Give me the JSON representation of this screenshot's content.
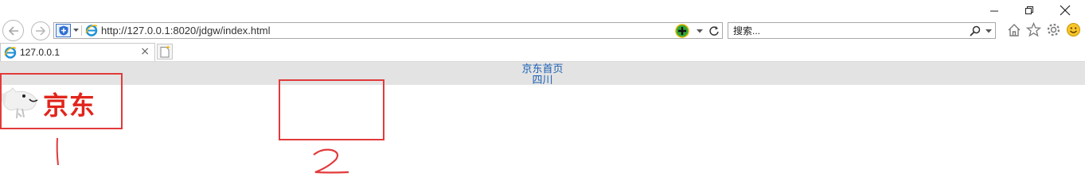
{
  "window": {
    "controls": [
      "minimize-icon",
      "restore-icon",
      "close-icon"
    ]
  },
  "toolbar": {
    "back_icon": "back-arrow-icon",
    "forward_icon": "forward-arrow-icon",
    "url": "http://127.0.0.1:8020/jdgw/index.html",
    "search_placeholder": "搜索...",
    "right_icons": [
      "home-icon",
      "favorites-star-icon",
      "settings-gear-icon",
      "feedback-smiley-icon"
    ]
  },
  "tabs": [
    {
      "title": "127.0.0.1",
      "close": "×"
    }
  ],
  "page": {
    "header_links": [
      "京东首页",
      "四川"
    ],
    "logo_text": "京东",
    "annotations": [
      "1",
      "2"
    ]
  },
  "colors": {
    "brand_red": "#e1251b",
    "annotation_red": "#e23a3a",
    "link_blue": "#1a5fb4",
    "header_gray": "#e3e3e3"
  }
}
